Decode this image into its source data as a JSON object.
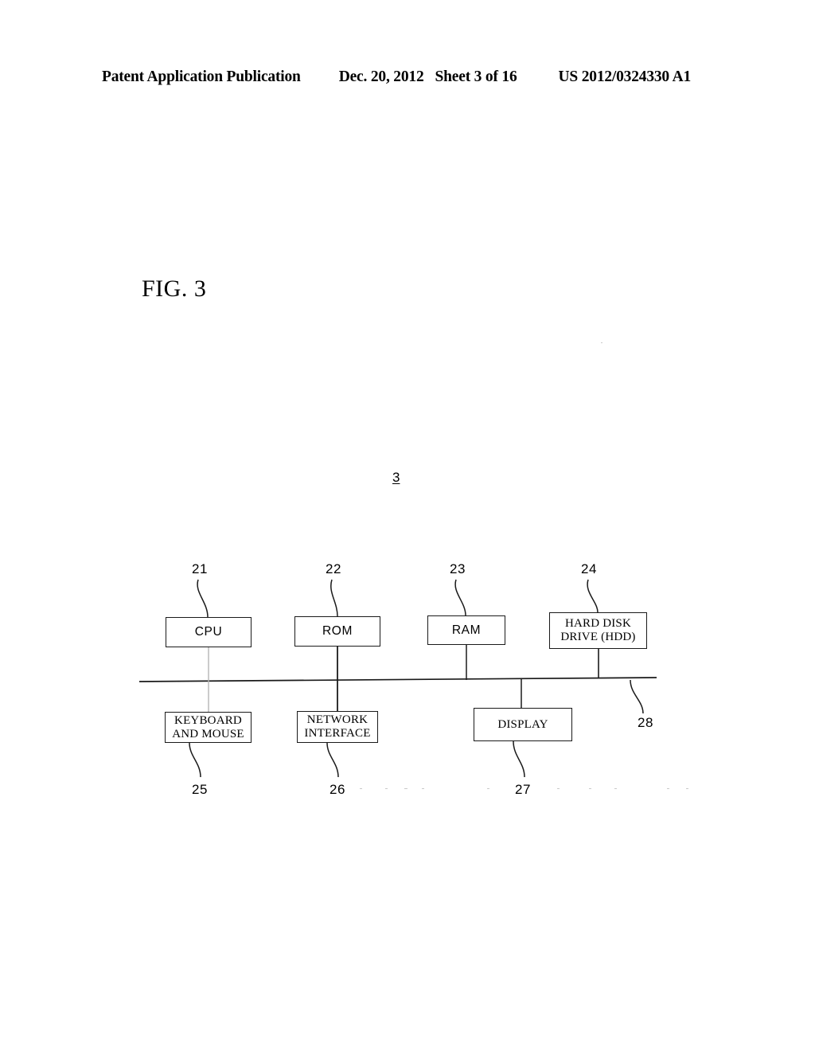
{
  "header": {
    "publication": "Patent Application Publication",
    "date": "Dec. 20, 2012",
    "sheet": "Sheet 3 of 16",
    "document_number": "US 2012/0324330 A1"
  },
  "figure": {
    "label": "FIG. 3",
    "system_reference": "3"
  },
  "diagram": {
    "nodes": [
      {
        "id": "cpu",
        "label": "CPU",
        "ref": "21"
      },
      {
        "id": "rom",
        "label": "ROM",
        "ref": "22"
      },
      {
        "id": "ram",
        "label": "RAM",
        "ref": "23"
      },
      {
        "id": "hdd",
        "label": "HARD DISK\nDRIVE (HDD)",
        "ref": "24"
      },
      {
        "id": "keyboard",
        "label": "KEYBOARD\nAND MOUSE",
        "ref": "25"
      },
      {
        "id": "network",
        "label": "NETWORK\nINTERFACE",
        "ref": "26"
      },
      {
        "id": "display",
        "label": "DISPLAY",
        "ref": "27"
      }
    ],
    "bus": {
      "label": "28",
      "name": "system-bus"
    },
    "refs": {
      "cpu": "21",
      "rom": "22",
      "ram": "23",
      "hdd": "24",
      "keyboard": "25",
      "network": "26",
      "display": "27",
      "bus": "28"
    },
    "line_color": "#1a1a1a"
  }
}
